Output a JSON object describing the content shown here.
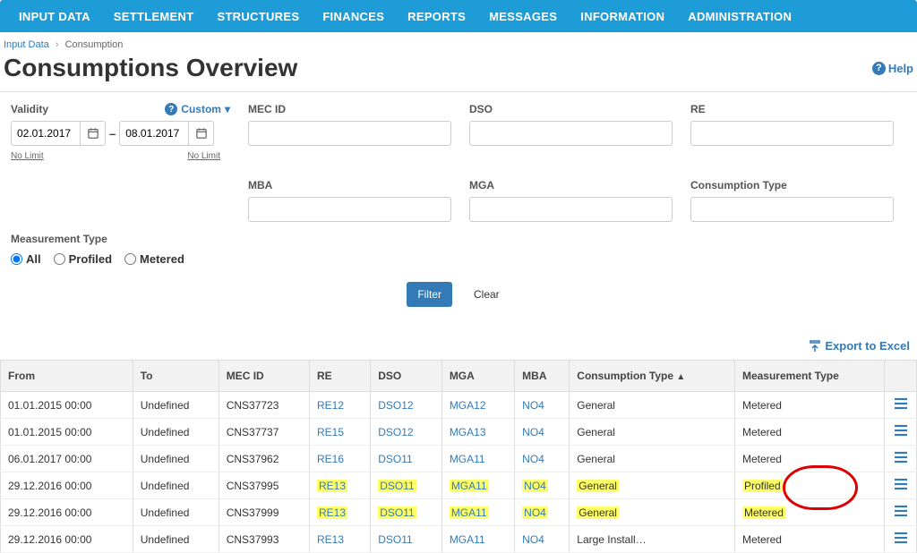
{
  "nav": [
    "INPUT DATA",
    "SETTLEMENT",
    "STRUCTURES",
    "FINANCES",
    "REPORTS",
    "MESSAGES",
    "INFORMATION",
    "ADMINISTRATION"
  ],
  "breadcrumb": {
    "root": "Input Data",
    "sep": "›",
    "leaf": "Consumption"
  },
  "title": "Consumptions Overview",
  "help": "Help",
  "filters": {
    "validity_label": "Validity",
    "custom": "Custom",
    "date_from": "02.01.2017",
    "date_to": "08.01.2017",
    "nolimit": "No Limit",
    "mec_label": "MEC ID",
    "dso_label": "DSO",
    "re_label": "RE",
    "mba_label": "MBA",
    "mga_label": "MGA",
    "ctype_label": "Consumption Type"
  },
  "measure": {
    "label": "Measurement Type",
    "all": "All",
    "profiled": "Profiled",
    "metered": "Metered"
  },
  "buttons": {
    "filter": "Filter",
    "clear": "Clear"
  },
  "export": "Export to Excel",
  "columns": {
    "from": "From",
    "to": "To",
    "mec": "MEC ID",
    "re": "RE",
    "dso": "DSO",
    "mga": "MGA",
    "mba": "MBA",
    "ctype": "Consumption Type",
    "mtype": "Measurement Type"
  },
  "rows": [
    {
      "from": "01.01.2015 00:00",
      "to": "Undefined",
      "mec": "CNS37723",
      "re": "RE12",
      "dso": "DSO12",
      "mga": "MGA12",
      "mba": "NO4",
      "ctype": "General",
      "mtype": "Metered",
      "hl": false
    },
    {
      "from": "01.01.2015 00:00",
      "to": "Undefined",
      "mec": "CNS37737",
      "re": "RE15",
      "dso": "DSO12",
      "mga": "MGA13",
      "mba": "NO4",
      "ctype": "General",
      "mtype": "Metered",
      "hl": false
    },
    {
      "from": "06.01.2017 00:00",
      "to": "Undefined",
      "mec": "CNS37962",
      "re": "RE16",
      "dso": "DSO11",
      "mga": "MGA11",
      "mba": "NO4",
      "ctype": "General",
      "mtype": "Metered",
      "hl": false
    },
    {
      "from": "29.12.2016 00:00",
      "to": "Undefined",
      "mec": "CNS37995",
      "re": "RE13",
      "dso": "DSO11",
      "mga": "MGA11",
      "mba": "NO4",
      "ctype": "General",
      "mtype": "Profiled",
      "hl": true
    },
    {
      "from": "29.12.2016 00:00",
      "to": "Undefined",
      "mec": "CNS37999",
      "re": "RE13",
      "dso": "DSO11",
      "mga": "MGA11",
      "mba": "NO4",
      "ctype": "General",
      "mtype": "Metered",
      "hl": true
    },
    {
      "from": "29.12.2016 00:00",
      "to": "Undefined",
      "mec": "CNS37993",
      "re": "RE13",
      "dso": "DSO11",
      "mga": "MGA11",
      "mba": "NO4",
      "ctype": "Large Install…",
      "mtype": "Metered",
      "hl": false
    }
  ]
}
